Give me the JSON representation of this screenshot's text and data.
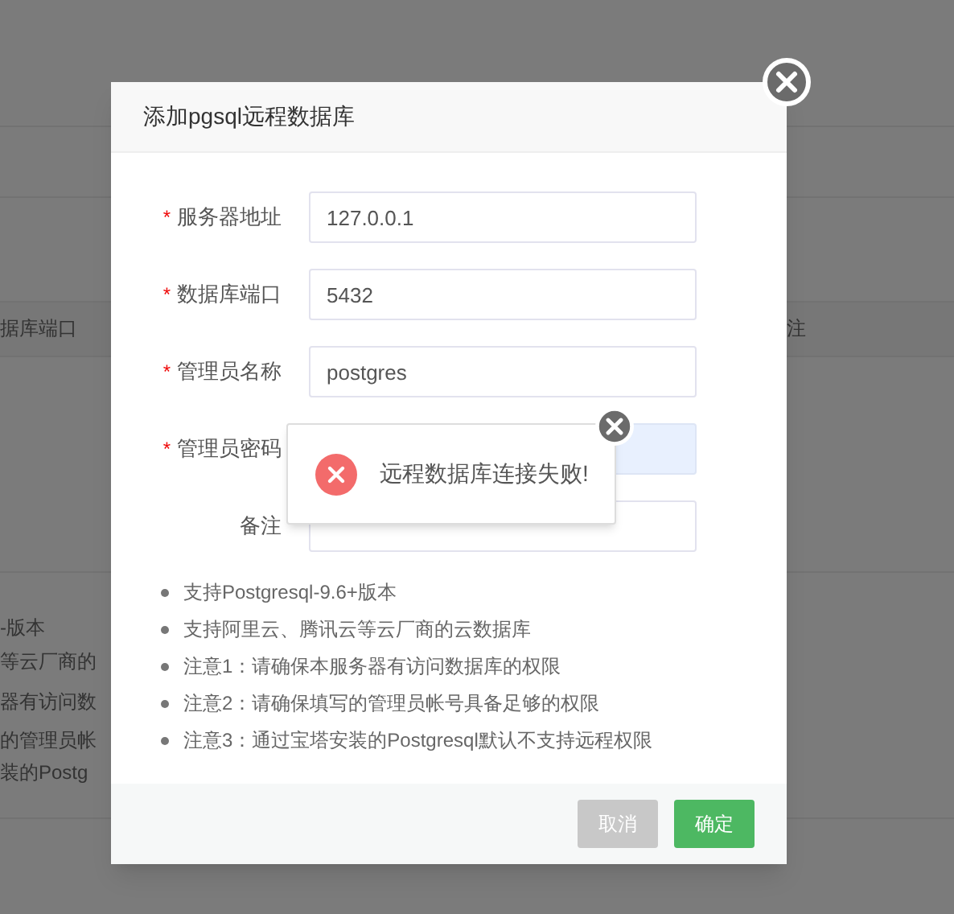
{
  "background": {
    "table_header": [
      "据库端口",
      "注"
    ],
    "column_1_lines": [
      "-版本",
      "等云厂商的",
      "器有访问数",
      "的管理员帐",
      "装的Postg"
    ]
  },
  "dialog": {
    "title": "添加pgsql远程数据库",
    "fields": [
      {
        "label": "服务器地址",
        "required_mark": "*",
        "value": "127.0.0.1",
        "autofilled": false
      },
      {
        "label": "数据库端口",
        "required_mark": "*",
        "value": "5432",
        "autofilled": false
      },
      {
        "label": "管理员名称",
        "required_mark": "*",
        "value": "postgres",
        "autofilled": false
      },
      {
        "label": "管理员密码",
        "required_mark": "*",
        "autofilled": true
      },
      {
        "label": "备注",
        "autofilled": false
      }
    ],
    "notes": [
      "支持Postgresql-9.6+版本",
      "支持阿里云、腾讯云等云厂商的云数据库",
      "注意1：请确保本服务器有访问数据库的权限",
      "注意2：请确保填写的管理员帐号具备足够的权限",
      "注意3：通过宝塔安装的Postgresql默认不支持远程权限"
    ],
    "buttons": [
      {
        "label": "取消",
        "kind": "cancel"
      },
      {
        "label": "确定",
        "kind": "primary"
      }
    ]
  },
  "toast": {
    "kind": "error",
    "message": "远程数据库连接失败!"
  }
}
